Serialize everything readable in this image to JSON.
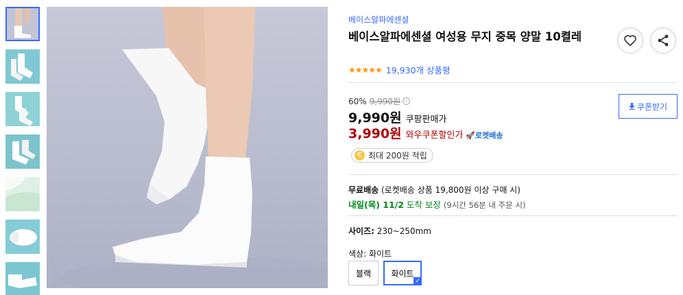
{
  "product": {
    "brand": "베이스알파에센셜",
    "title": "베이스알파에센셜 여성용 무지 중목 양말 10켤레",
    "rating_stars": "★★★★★",
    "review_count": "19,930개 상품평"
  },
  "pricing": {
    "discount_rate": "60%",
    "original_price": "9,990원",
    "coupang_price": "9,990원",
    "coupang_label": "쿠팡판매가",
    "wow_price": "3,990원",
    "wow_label": "와우쿠폰할인가",
    "rocket_label": "로켓배송",
    "coupon_button": "쿠폰받기"
  },
  "points": {
    "coin": "C",
    "text": "최대 200원 적립"
  },
  "shipping": {
    "free_label": "무료배송",
    "free_detail": "(로켓배송 상품 19,800원 이상 구매 시)",
    "arrival": "내일(목) 11/2",
    "arrival_suffix": "도착 보장",
    "arrival_note": "(9시간 56분 내 주문 시)"
  },
  "options": {
    "size_label": "사이즈:",
    "size_value": "230~250mm",
    "color_label": "색상:",
    "color_value": "화이트",
    "colors": [
      "블랙",
      "화이트"
    ]
  },
  "colors": {
    "accent": "#346aff",
    "price_red": "#ae0000",
    "green": "#00891a",
    "star": "#ff9600"
  }
}
